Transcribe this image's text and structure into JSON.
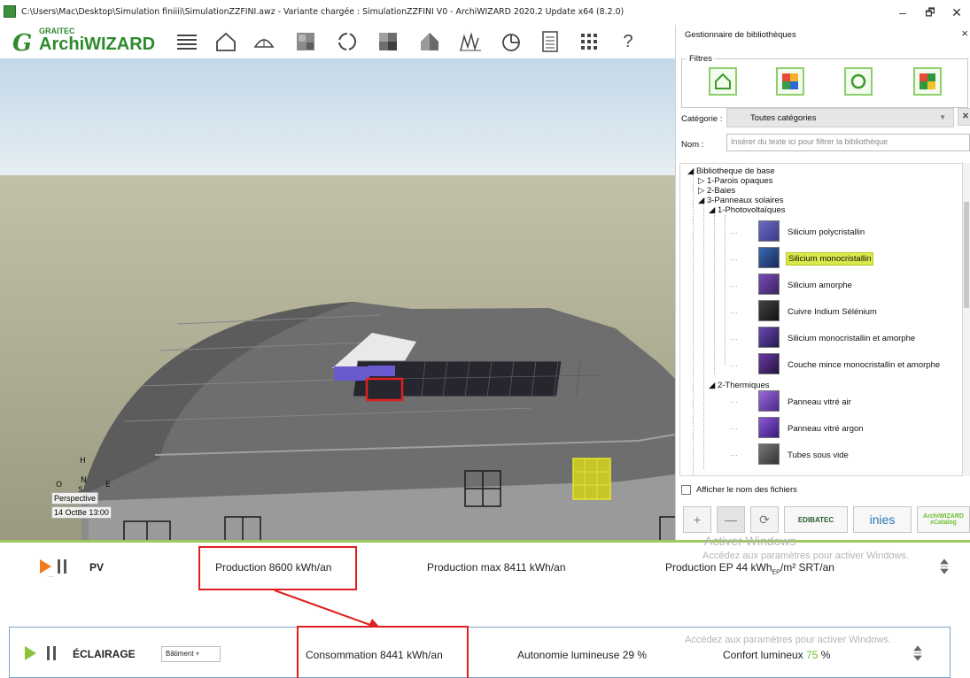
{
  "window": {
    "title": "C:\\Users\\Mac\\Desktop\\Simulation finiiii\\SimulationZZFINI.awz - Variante chargée : SimulationZZFINI V0 - ArchiWIZARD 2020.2 Update x64 (8.2.0)",
    "minimize": "–",
    "maximize": "🗗",
    "close": "✕"
  },
  "brand": {
    "small": "GRAITEC",
    "main": "ArchiWIZARD",
    "accent": "#2d8a2d"
  },
  "toolbar": {
    "icons": [
      "menu-icon",
      "home-icon",
      "dome-icon",
      "wall-icon",
      "circle-icon",
      "panel-icon",
      "house-icon",
      "chart-icon",
      "pie-icon",
      "document-icon",
      "grid-icon",
      "help-icon"
    ]
  },
  "viewport": {
    "compass": {
      "north": "N",
      "south": "S",
      "east": "E",
      "west": "O",
      "up": "H"
    },
    "view_mode": "Perspective",
    "date_prefix": "14 Oct",
    "date_partial": "B",
    "date_suffix": "e 13:00"
  },
  "library": {
    "title": "Gestionnaire de bibliothèques",
    "filters_label": "Filtres",
    "category_label": "Catégorie :",
    "category_value": "Toutes catégories",
    "name_label": "Nom :",
    "name_placeholder": "Insérer du texte ici pour filtrer la bibliothèque",
    "tree": {
      "root": "Bibliotheque de base",
      "n1": "1-Parois opaques",
      "n2": "2-Baies",
      "n3": "3-Panneaux solaires",
      "n31": "1-Photovoltaïques",
      "n32": "2-Thermiques",
      "pv_items": [
        "Silicium polycristallin",
        "Silicium monocristallin",
        "Silicium amorphe",
        "Cuivre Indium Sélénium",
        "Silicium monocristallin et amorphe",
        "Couche mince monocristallin et amorphe"
      ],
      "th_items": [
        "Panneau vitré air",
        "Panneau vitré argon",
        "Tubes sous vide"
      ],
      "selected": "Silicium monocristallin",
      "highlight": "#d9e84a"
    },
    "show_filenames": "Afficher le nom des fichiers",
    "partners": [
      "EDIBATEC",
      "inies",
      "ArchiWIZARD",
      "eCatalog"
    ]
  },
  "pv": {
    "label": "PV",
    "production": "Production 8600 kWh/an",
    "production_max": "Production max 8411 kWh/an",
    "production_ep_pre": "Production EP 44 kWh",
    "production_ep_sub": "EP",
    "production_ep_post": "/m² SRT/an",
    "activate_1": "Activer Windows",
    "activate_2": "Accédez aux paramètres pour activer Windows."
  },
  "eclairage": {
    "label": "ÉCLAIRAGE",
    "scope": "Bâtiment",
    "consommation": "Consommation 8441 kWh/an",
    "autonomie": "Autonomie lumineuse 29 %",
    "confort_pre": "Confort lumineux",
    "confort_value": "75",
    "confort_post": "%",
    "activate": "Accédez aux paramètres pour activer Windows."
  }
}
